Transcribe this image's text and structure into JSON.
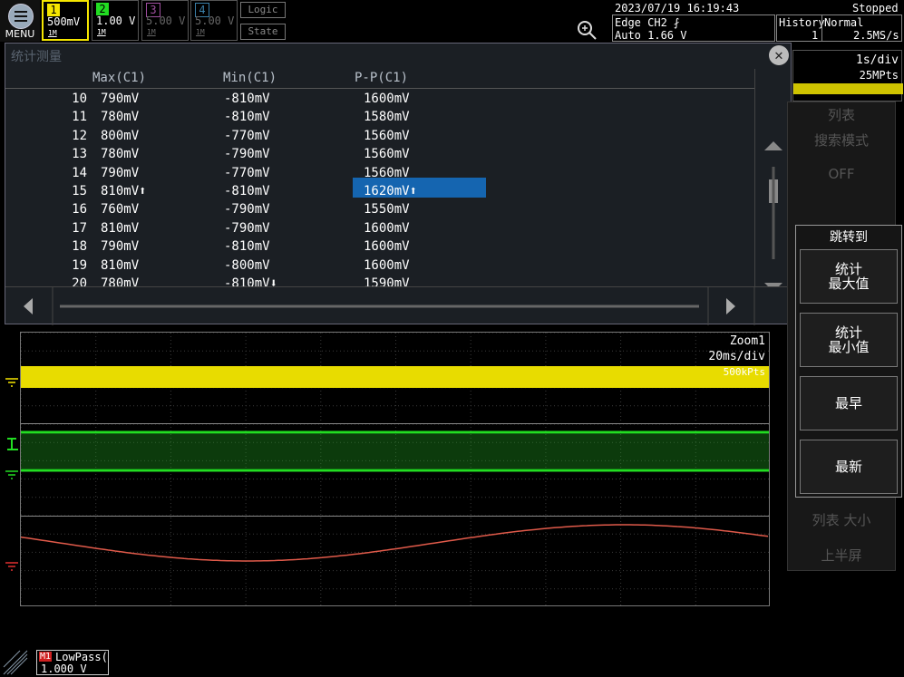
{
  "menu": {
    "label": "MENU"
  },
  "channels": [
    {
      "num": "1",
      "value": "500mV",
      "tag": "1M",
      "color": "#f5e600",
      "active": true
    },
    {
      "num": "2",
      "value": "1.00 V",
      "tag": "1M",
      "color": "#22dd22",
      "active": true
    },
    {
      "num": "3",
      "value": "5.00 V",
      "tag": "1M",
      "color": "#cc55cc",
      "active": false
    },
    {
      "num": "4",
      "value": "5.00 V",
      "tag": "1M",
      "color": "#4499cc",
      "active": false
    }
  ],
  "logic_label": "Logic",
  "state_label": "State",
  "datetime": "2023/07/19 16:19:43",
  "run_status": "Stopped",
  "trigger": {
    "line1": "Edge CH2 ⨏",
    "line2": "Auto 1.66 V"
  },
  "history": {
    "label": "History",
    "value": "1"
  },
  "acq": {
    "mode": "Normal",
    "rate": "2.5MS/s"
  },
  "timebase": {
    "div": "1s/div",
    "pts": "25MPts"
  },
  "stats": {
    "title": "统计测量",
    "columns": [
      "Max(C1)",
      "Min(C1)",
      "P-P(C1)"
    ],
    "rows": [
      [
        "10",
        "790mV",
        "-810mV",
        "1600mV"
      ],
      [
        "11",
        "780mV",
        "-810mV",
        "1580mV"
      ],
      [
        "12",
        "800mV",
        "-770mV",
        "1560mV"
      ],
      [
        "13",
        "780mV",
        "-790mV",
        "1560mV"
      ],
      [
        "14",
        "790mV",
        "-770mV",
        "1560mV"
      ],
      [
        "15",
        "810mV⬆",
        "-810mV",
        "1620mV⬆"
      ],
      [
        "16",
        "760mV",
        "-790mV",
        "1550mV"
      ],
      [
        "17",
        "810mV",
        "-790mV",
        "1600mV"
      ],
      [
        "18",
        "790mV",
        "-810mV",
        "1600mV"
      ],
      [
        "19",
        "810mV",
        "-800mV",
        "1600mV"
      ],
      [
        "20",
        "780mV",
        "-810mV⬇",
        "1590mV"
      ]
    ]
  },
  "side_menu": {
    "list": "列表",
    "search_mode": "搜索模式",
    "off": "OFF",
    "list_size": "列表 大小",
    "upper_half": "上半屏"
  },
  "jump": {
    "title": "跳转到",
    "stat_max": "统计\n最大值",
    "stat_min": "统计\n最小值",
    "earliest": "最早",
    "latest": "最新"
  },
  "zoom": {
    "name": "Zoom1",
    "div": "20ms/div",
    "pts": "500kPts"
  },
  "math": {
    "tag": "M1",
    "name": "LowPass(C",
    "value": "1.000 V"
  }
}
